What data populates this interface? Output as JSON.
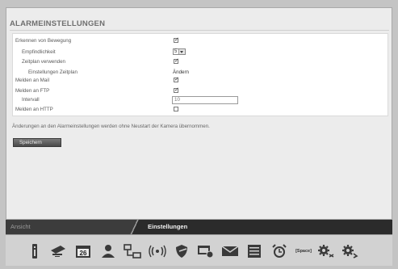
{
  "page": {
    "title": "ALARMEINSTELLUNGEN"
  },
  "form": {
    "rows": [
      {
        "label": "Erkennen von Bewegung",
        "checked": true
      },
      {
        "label": "Empfindlichkeit",
        "select_value": "5"
      },
      {
        "label": "Zeitplan verwenden",
        "checked": true
      },
      {
        "label": "Einstellungen Zeitplan",
        "link": "Ändern"
      },
      {
        "label": "Melden an Mail",
        "checked": true
      },
      {
        "label": "Melden an FTP",
        "checked": true
      },
      {
        "label": "Intervall",
        "input_value": "10"
      },
      {
        "label": "Melden an HTTP",
        "checked": false
      }
    ]
  },
  "note": "Änderungen an den Alarmeinstellungen werden ohne Neustart der Kamera übernommen.",
  "save_label": "Speichern",
  "tabs": {
    "left": "Ansicht",
    "right": "Einstellungen"
  },
  "toolbar": {
    "icons": [
      "info-icon",
      "network-icon",
      "date-icon",
      "user-icon",
      "lan-icon",
      "wireless-icon",
      "shield-icon",
      "camera-settings-icon",
      "mail-icon",
      "storage-icon",
      "alarm-icon",
      "space-icon",
      "config-icon",
      "advanced-icon"
    ],
    "space_label": "[Space]",
    "date_label": "26"
  }
}
